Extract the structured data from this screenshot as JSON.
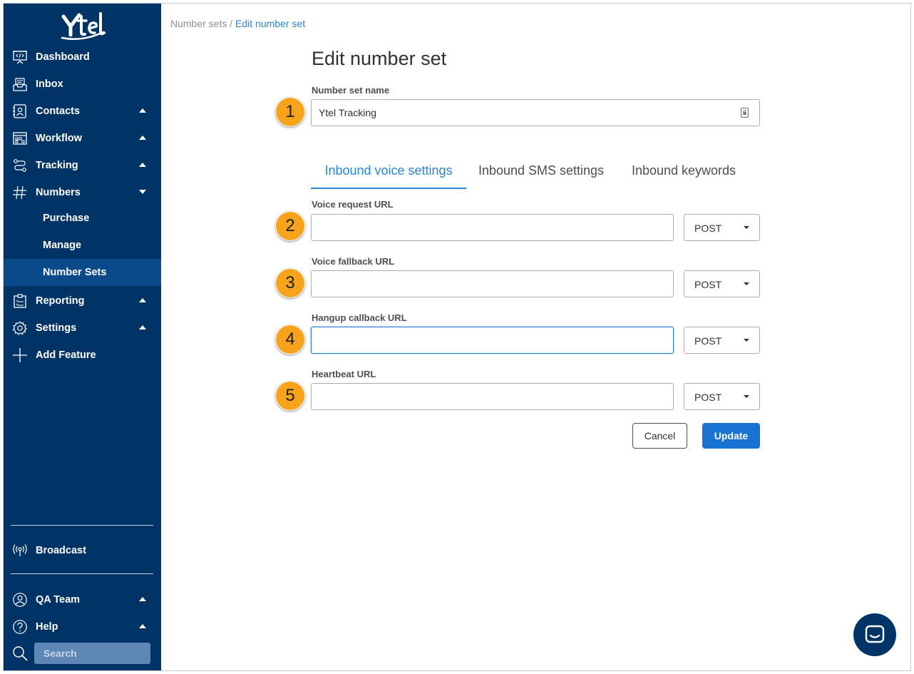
{
  "brand": {
    "logo_text": "Ytel"
  },
  "sidebar": {
    "items": [
      {
        "label": "Dashboard",
        "icon": "dashboard-icon",
        "caret": "none"
      },
      {
        "label": "Inbox",
        "icon": "inbox-icon",
        "caret": "none"
      },
      {
        "label": "Contacts",
        "icon": "contacts-icon",
        "caret": "up"
      },
      {
        "label": "Workflow",
        "icon": "workflow-icon",
        "caret": "up"
      },
      {
        "label": "Tracking",
        "icon": "tracking-icon",
        "caret": "up"
      },
      {
        "label": "Numbers",
        "icon": "hash-icon",
        "caret": "down"
      },
      {
        "label": "Reporting",
        "icon": "clipboard-icon",
        "caret": "up"
      },
      {
        "label": "Settings",
        "icon": "gear-icon",
        "caret": "up"
      },
      {
        "label": "Add Feature",
        "icon": "plus-icon",
        "caret": "none"
      }
    ],
    "numbers_subitems": [
      {
        "label": "Purchase",
        "active": false
      },
      {
        "label": "Manage",
        "active": false
      },
      {
        "label": "Number Sets",
        "active": true
      }
    ],
    "broadcast": {
      "label": "Broadcast",
      "icon": "broadcast-icon"
    },
    "team": {
      "label": "QA Team",
      "icon": "user-icon",
      "caret": "up"
    },
    "help": {
      "label": "Help",
      "icon": "help-icon",
      "caret": "up"
    },
    "search": {
      "placeholder": "Search",
      "icon": "search-icon"
    }
  },
  "breadcrumb": {
    "parent": "Number sets",
    "separator": "/",
    "current": "Edit number set"
  },
  "page": {
    "title": "Edit number set",
    "name_field": {
      "label": "Number set name",
      "value": "Ytel Tracking",
      "step": "1"
    }
  },
  "tabs": [
    {
      "label": "Inbound voice settings",
      "active": true
    },
    {
      "label": "Inbound SMS settings",
      "active": false
    },
    {
      "label": "Inbound keywords",
      "active": false
    }
  ],
  "url_fields": [
    {
      "label": "Voice request URL",
      "value": "",
      "method": "POST",
      "step": "2",
      "focused": false
    },
    {
      "label": "Voice fallback URL",
      "value": "",
      "method": "POST",
      "step": "3",
      "focused": false
    },
    {
      "label": "Hangup callback URL",
      "value": "",
      "method": "POST",
      "step": "4",
      "focused": true
    },
    {
      "label": "Heartbeat URL",
      "value": "",
      "method": "POST",
      "step": "5",
      "focused": false
    }
  ],
  "actions": {
    "cancel_label": "Cancel",
    "update_label": "Update"
  },
  "colors": {
    "sidebar_bg": "#003366",
    "sidebar_active": "#0b4a8a",
    "accent": "#2d83d6",
    "primary_button": "#1a73d1",
    "step_badge": "#f7a31c"
  },
  "chat": {
    "icon": "chat-icon"
  }
}
